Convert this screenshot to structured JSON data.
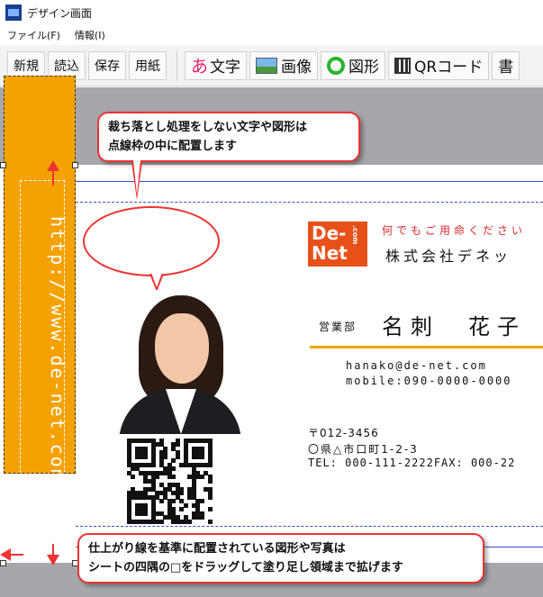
{
  "window": {
    "title": "デザイン画面"
  },
  "menu": {
    "file": "ファイル(F)",
    "info": "情報(I)"
  },
  "toolbar": {
    "new": "新規",
    "load": "読込",
    "save": "保存",
    "paper": "用紙",
    "text_icon": "あ",
    "text": "文字",
    "image": "画像",
    "shape": "図形",
    "qrcode": "QRコード",
    "more": "書"
  },
  "callouts": {
    "top_line1": "裁ち落とし処理をしない文字や図形は",
    "top_line2": "点線枠の中に配置します",
    "bottom_line1": "仕上がり線を基準に配置されている図形や写真は",
    "bottom_line2": "シートの四隅の□をドラッグして塗り足し領域まで拡げます"
  },
  "card": {
    "url": "http://www.de-net.com/",
    "logo": "De-Net",
    "logo_sub": ".com",
    "tagline": "何でもご用命ください",
    "company": "株式会社デネッ",
    "department": "営業部",
    "name": "名刺　花子",
    "email": "hanako@de-net.com",
    "mobile": "mobile:090-0000-0000",
    "zip": "〒012-3456",
    "address": "〇県△市口町1-2-3",
    "tel_fax": "TEL: 000-111-2222FAX: 000-22"
  }
}
